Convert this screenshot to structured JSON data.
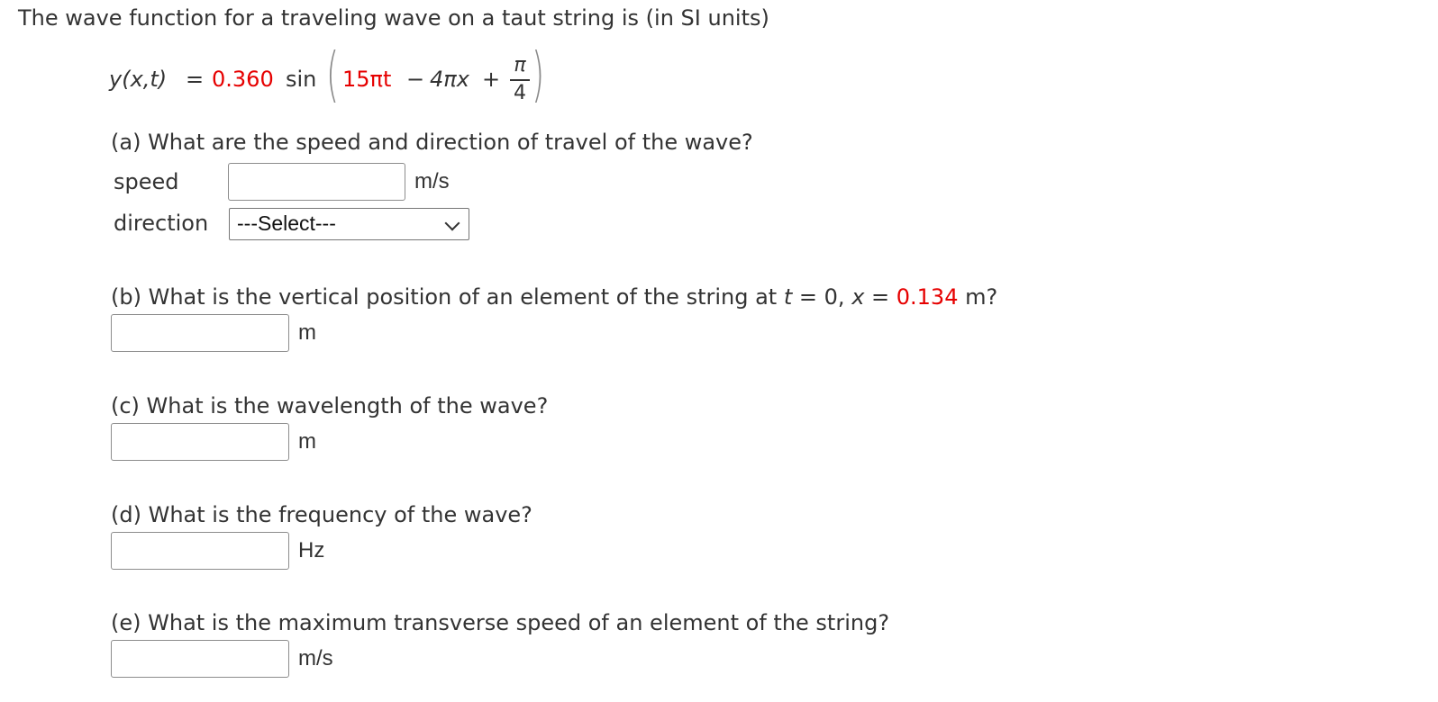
{
  "intro": "The wave function for a traveling wave on a taut string is (in SI units)",
  "equation": {
    "lhs": "y(x,t)",
    "equals": "=",
    "amplitude": "0.360",
    "func": "sin",
    "omega_t": "15πt",
    "minus": "−",
    "k_x": "4πx",
    "plus": "+",
    "phase_num": "π",
    "phase_den": "4"
  },
  "part_a": {
    "question": "(a) What are the speed and direction of travel of the wave?",
    "speed_label": "speed",
    "speed_value": "",
    "speed_unit": "m/s",
    "direction_label": "direction",
    "direction_selected": "---Select---"
  },
  "part_b": {
    "question_pre": "(b) What is the vertical position of an element of the string at ",
    "t_var": "t",
    "t_eq": " = 0, ",
    "x_var": "x",
    "x_eq": " = ",
    "x_value": "0.134",
    "question_post": " m?",
    "value": "",
    "unit": "m"
  },
  "part_c": {
    "question": "(c) What is the wavelength of the wave?",
    "value": "",
    "unit": "m"
  },
  "part_d": {
    "question": "(d) What is the frequency of the wave?",
    "value": "",
    "unit": "Hz"
  },
  "part_e": {
    "question": "(e) What is the maximum transverse speed of an element of the string?",
    "value": "",
    "unit": "m/s"
  },
  "colors": {
    "given_value": "#e60000",
    "text": "#333333"
  }
}
